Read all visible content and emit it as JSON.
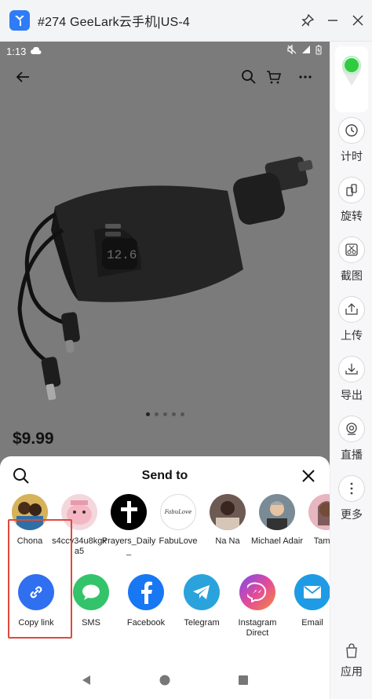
{
  "window": {
    "title": "#274 GeeLark云手机|US-4"
  },
  "status": {
    "time": "1:13"
  },
  "product": {
    "price": "$9.99",
    "carousel_count": 5,
    "carousel_active": 1
  },
  "share": {
    "title": "Send to",
    "contacts": [
      {
        "name": "Chona"
      },
      {
        "name": "s4ccv34u8kgxa5"
      },
      {
        "name": "Prayers_Daily_"
      },
      {
        "name": "FabuLove",
        "logo_text": "FabuLove"
      },
      {
        "name": "Na Na"
      },
      {
        "name": "Michael Adair"
      },
      {
        "name": "Tamac"
      }
    ],
    "targets": [
      {
        "label": "Copy link",
        "color": "#2f6ff0"
      },
      {
        "label": "SMS",
        "color": "#33c36a"
      },
      {
        "label": "Facebook",
        "color": "#1877f2"
      },
      {
        "label": "Telegram",
        "color": "#2aa3dd"
      },
      {
        "label": "Instagram Direct",
        "color": "#b946e8"
      },
      {
        "label": "Email",
        "color": "#1e9be4"
      }
    ]
  },
  "sidebar": {
    "items": [
      {
        "label": "计时",
        "icon": "clock-icon"
      },
      {
        "label": "旋转",
        "icon": "rotate-icon"
      },
      {
        "label": "截图",
        "icon": "screenshot-icon"
      },
      {
        "label": "上传",
        "icon": "upload-icon"
      },
      {
        "label": "导出",
        "icon": "download-icon"
      },
      {
        "label": "直播",
        "icon": "camera-icon"
      },
      {
        "label": "更多",
        "icon": "more-icon"
      }
    ],
    "bottom": {
      "label": "应用",
      "icon": "bag-icon"
    }
  },
  "colors": {
    "accent_green": "#2ecc40",
    "highlight": "#e0483b"
  }
}
